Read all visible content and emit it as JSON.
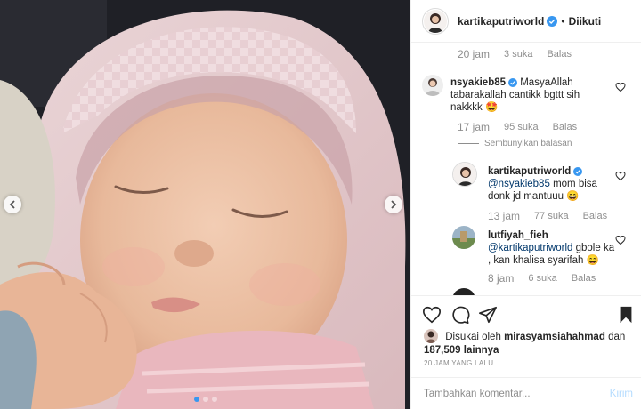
{
  "header": {
    "username": "kartikaputriworld",
    "separator": "•",
    "follow_label": "Diikuti"
  },
  "comments": {
    "prev_meta": {
      "time": "20 jam",
      "likes": "3 suka",
      "reply": "Balas"
    },
    "items": [
      {
        "username": "nsyakieb85",
        "text": "MasyaAllah tabarakallah cantikk bgttt sih nakkkk",
        "emoji": "🤩",
        "time": "17 jam",
        "likes": "95 suka",
        "reply": "Balas"
      }
    ],
    "hide_replies_label": "Sembunyikan balasan",
    "replies": [
      {
        "username": "kartikaputriworld",
        "mention": "@nsyakieb85",
        "text": "mom bisa donk jd mantuuu",
        "emoji": "😄",
        "time": "13 jam",
        "likes": "77 suka",
        "reply": "Balas"
      },
      {
        "username": "lutfiyah_fieh",
        "mention": "@kartikaputriworld",
        "text": "gbole ka , kan khalisa syarifah",
        "emoji": "😄",
        "time": "8 jam",
        "likes": "6 suka",
        "reply": "Balas"
      }
    ]
  },
  "likes": {
    "prefix": "Disukai oleh",
    "liker": "mirasyamsiahahmad",
    "connector": "dan",
    "count": "187,509",
    "suffix": "lainnya"
  },
  "timestamp": "20 JAM YANG LALU",
  "add_comment": {
    "placeholder": "Tambahkan komentar...",
    "post_label": "Kirim"
  },
  "carousel": {
    "total": 3,
    "active_index": 1
  },
  "colors": {
    "accent": "#3897f0",
    "verified": "#3897f0",
    "post_disabled": "#b3dbff",
    "muted": "#8e8e8e"
  },
  "icons": [
    "chevron-left-icon",
    "chevron-right-icon",
    "verified-icon",
    "heart-icon",
    "comment-icon",
    "share-icon",
    "bookmark-icon"
  ]
}
